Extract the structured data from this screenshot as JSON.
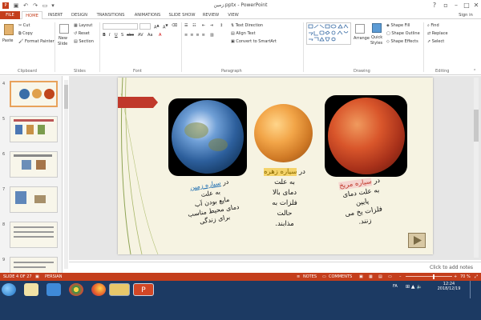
{
  "app": {
    "window_title": "زمین.pptx - PowerPoint",
    "sign_in": "Sign in",
    "help": "?"
  },
  "tabs": [
    "FILE",
    "HOME",
    "INSERT",
    "DESIGN",
    "TRANSITIONS",
    "ANIMATIONS",
    "SLIDE SHOW",
    "REVIEW",
    "VIEW"
  ],
  "ribbon": {
    "clipboard": {
      "paste": "Paste",
      "cut": "Cut",
      "copy": "Copy",
      "format_painter": "Format Painter",
      "group": "Clipboard"
    },
    "slides": {
      "new_slide": "New",
      "new_slide_2": "Slide",
      "layout": "Layout",
      "reset": "Reset",
      "section": "Section",
      "group": "Slides"
    },
    "font": {
      "group": "Font"
    },
    "paragraph": {
      "text_direction": "Text Direction",
      "align_text": "Align Text",
      "convert_smartart": "Convert to SmartArt",
      "group": "Paragraph"
    },
    "drawing": {
      "arrange": "Arrange",
      "quick_styles": "Quick",
      "quick_styles_2": "Styles",
      "shape_fill": "Shape Fill",
      "shape_outline": "Shape Outline",
      "shape_effects": "Shape Effects",
      "group": "Drawing"
    },
    "editing": {
      "find": "Find",
      "replace": "Replace",
      "select": "Select",
      "group": "Editing"
    }
  },
  "thumbnails": {
    "numbers": [
      "4",
      "5",
      "6",
      "7",
      "8",
      "9"
    ],
    "selected": "4"
  },
  "slide": {
    "earth": {
      "heading_prefix": "در",
      "heading_link": "سیاره زمین",
      "lines": [
        "به علت",
        "مایع بودن آب",
        "دمای محیط مناسب",
        "برای زندگی"
      ]
    },
    "venus": {
      "heading_prefix": "در",
      "heading_link": "سیاره زهره",
      "lines": [
        "به علت",
        "دمای بالا",
        "فلزات به",
        "حالت",
        "مذابند."
      ]
    },
    "mars": {
      "heading_prefix": "در",
      "heading_link": "سیاره مریخ",
      "lines": [
        "به علت دمای",
        "پایین",
        "فلزات یخ می",
        "زنند."
      ]
    }
  },
  "notes": {
    "placeholder": "Click to add notes"
  },
  "status": {
    "slide_count": "SLIDE 4 OF 27",
    "language": "PERSIAN",
    "notes": "NOTES",
    "comments": "COMMENTS",
    "zoom": "70 %"
  },
  "taskbar": {
    "lang": "FA",
    "time": "12:24",
    "date": "2018/12/19"
  },
  "colors": {
    "accent": "#c43e1c",
    "taskbar": "#1c3a63",
    "link": "#1f6fb2",
    "ribbon_red": "#c0392b"
  }
}
